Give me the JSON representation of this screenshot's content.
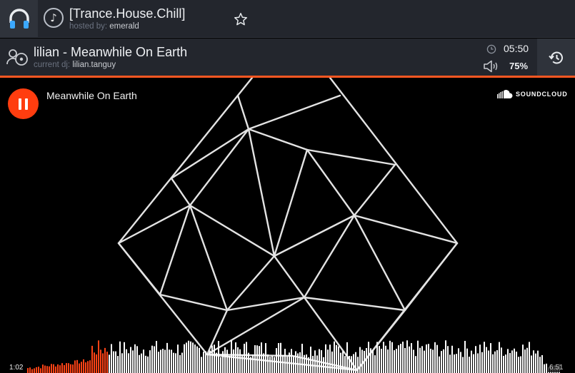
{
  "room": {
    "title": "[Trance.House.Chill]",
    "host_prefix": "hosted by:",
    "host_name": "emerald"
  },
  "now_playing": {
    "title": "lilian - Meanwhile On Earth",
    "dj_prefix": "current dj:",
    "dj_name": "lilian.tanguy",
    "time_remaining": "05:50",
    "volume": "75%"
  },
  "player": {
    "track_title": "Meanwhile On Earth",
    "provider": "SOUNDCLOUD",
    "elapsed": "1:02",
    "duration": "6:51",
    "progress": 0.151
  },
  "colors": {
    "accent": "#ff5722",
    "play_button": "#ff3d0f",
    "bar_bg": "#23262d",
    "icon_box": "#2f333b",
    "waveform_played": "#ff4316",
    "waveform_unplayed": "#ffffff"
  },
  "icons": {
    "logo": "headphones-icon",
    "room": "music-note-icon",
    "favorite": "star-icon",
    "dj": "dj-user-icon",
    "clock": "clock-icon",
    "volume": "volume-icon",
    "history": "history-icon",
    "soundcloud": "soundcloud-cloud-icon"
  }
}
